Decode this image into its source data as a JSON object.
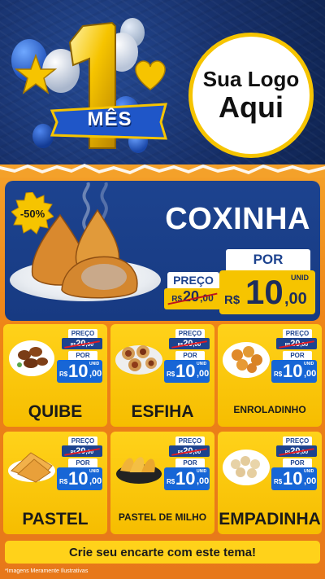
{
  "header": {
    "campaign_number": "1",
    "campaign_word": "MÊS",
    "logo_line1": "Sua Logo",
    "logo_line2": "Aqui"
  },
  "hero": {
    "discount_badge": "-50%",
    "title": "COXINHA",
    "preco_label": "PREÇO",
    "old_price": {
      "currency": "R$",
      "whole": "20",
      "cents": ",00"
    },
    "por_label": "POR",
    "new_price": {
      "currency": "R$",
      "whole": "10",
      "cents": ",00",
      "unit": "UNID"
    }
  },
  "products": [
    {
      "name": "QUIBE",
      "icon": "quibe-icon",
      "preco_label": "PREÇO",
      "old_whole": "20",
      "old_cents": ",00",
      "por_label": "POR",
      "currency": "R$",
      "whole": "10",
      "cents": ",00",
      "unit": "UNID"
    },
    {
      "name": "ESFIHA",
      "icon": "esfiha-icon",
      "preco_label": "PREÇO",
      "old_whole": "20",
      "old_cents": ",00",
      "por_label": "POR",
      "currency": "R$",
      "whole": "10",
      "cents": ",00",
      "unit": "UNID"
    },
    {
      "name": "ENROLADINHO",
      "icon": "enroladinho-icon",
      "preco_label": "PREÇO",
      "old_whole": "20",
      "old_cents": ",00",
      "por_label": "POR",
      "currency": "R$",
      "whole": "10",
      "cents": ",00",
      "unit": "UNID"
    },
    {
      "name": "PASTEL",
      "icon": "pastel-icon",
      "preco_label": "PREÇO",
      "old_whole": "20",
      "old_cents": ",00",
      "por_label": "POR",
      "currency": "R$",
      "whole": "10",
      "cents": ",00",
      "unit": "UNID"
    },
    {
      "name": "PASTEL DE MILHO",
      "icon": "pastel-de-milho-icon",
      "preco_label": "PREÇO",
      "old_whole": "20",
      "old_cents": ",00",
      "por_label": "POR",
      "currency": "R$",
      "whole": "10",
      "cents": ",00",
      "unit": "UNID"
    },
    {
      "name": "EMPADINHA",
      "icon": "empadinha-icon",
      "preco_label": "PREÇO",
      "old_whole": "20",
      "old_cents": ",00",
      "por_label": "POR",
      "currency": "R$",
      "whole": "10",
      "cents": ",00",
      "unit": "UNID"
    }
  ],
  "footer": {
    "cta": "Crie seu encarte com este tema!",
    "note": "*Imagens Meramente Ilustrativas"
  },
  "colors": {
    "header_blue": "#17306a",
    "band_orange": "#ee8417",
    "card_yellow": "#ffd21a",
    "hero_blue": "#1d438f",
    "price_blue": "#1766d6"
  }
}
